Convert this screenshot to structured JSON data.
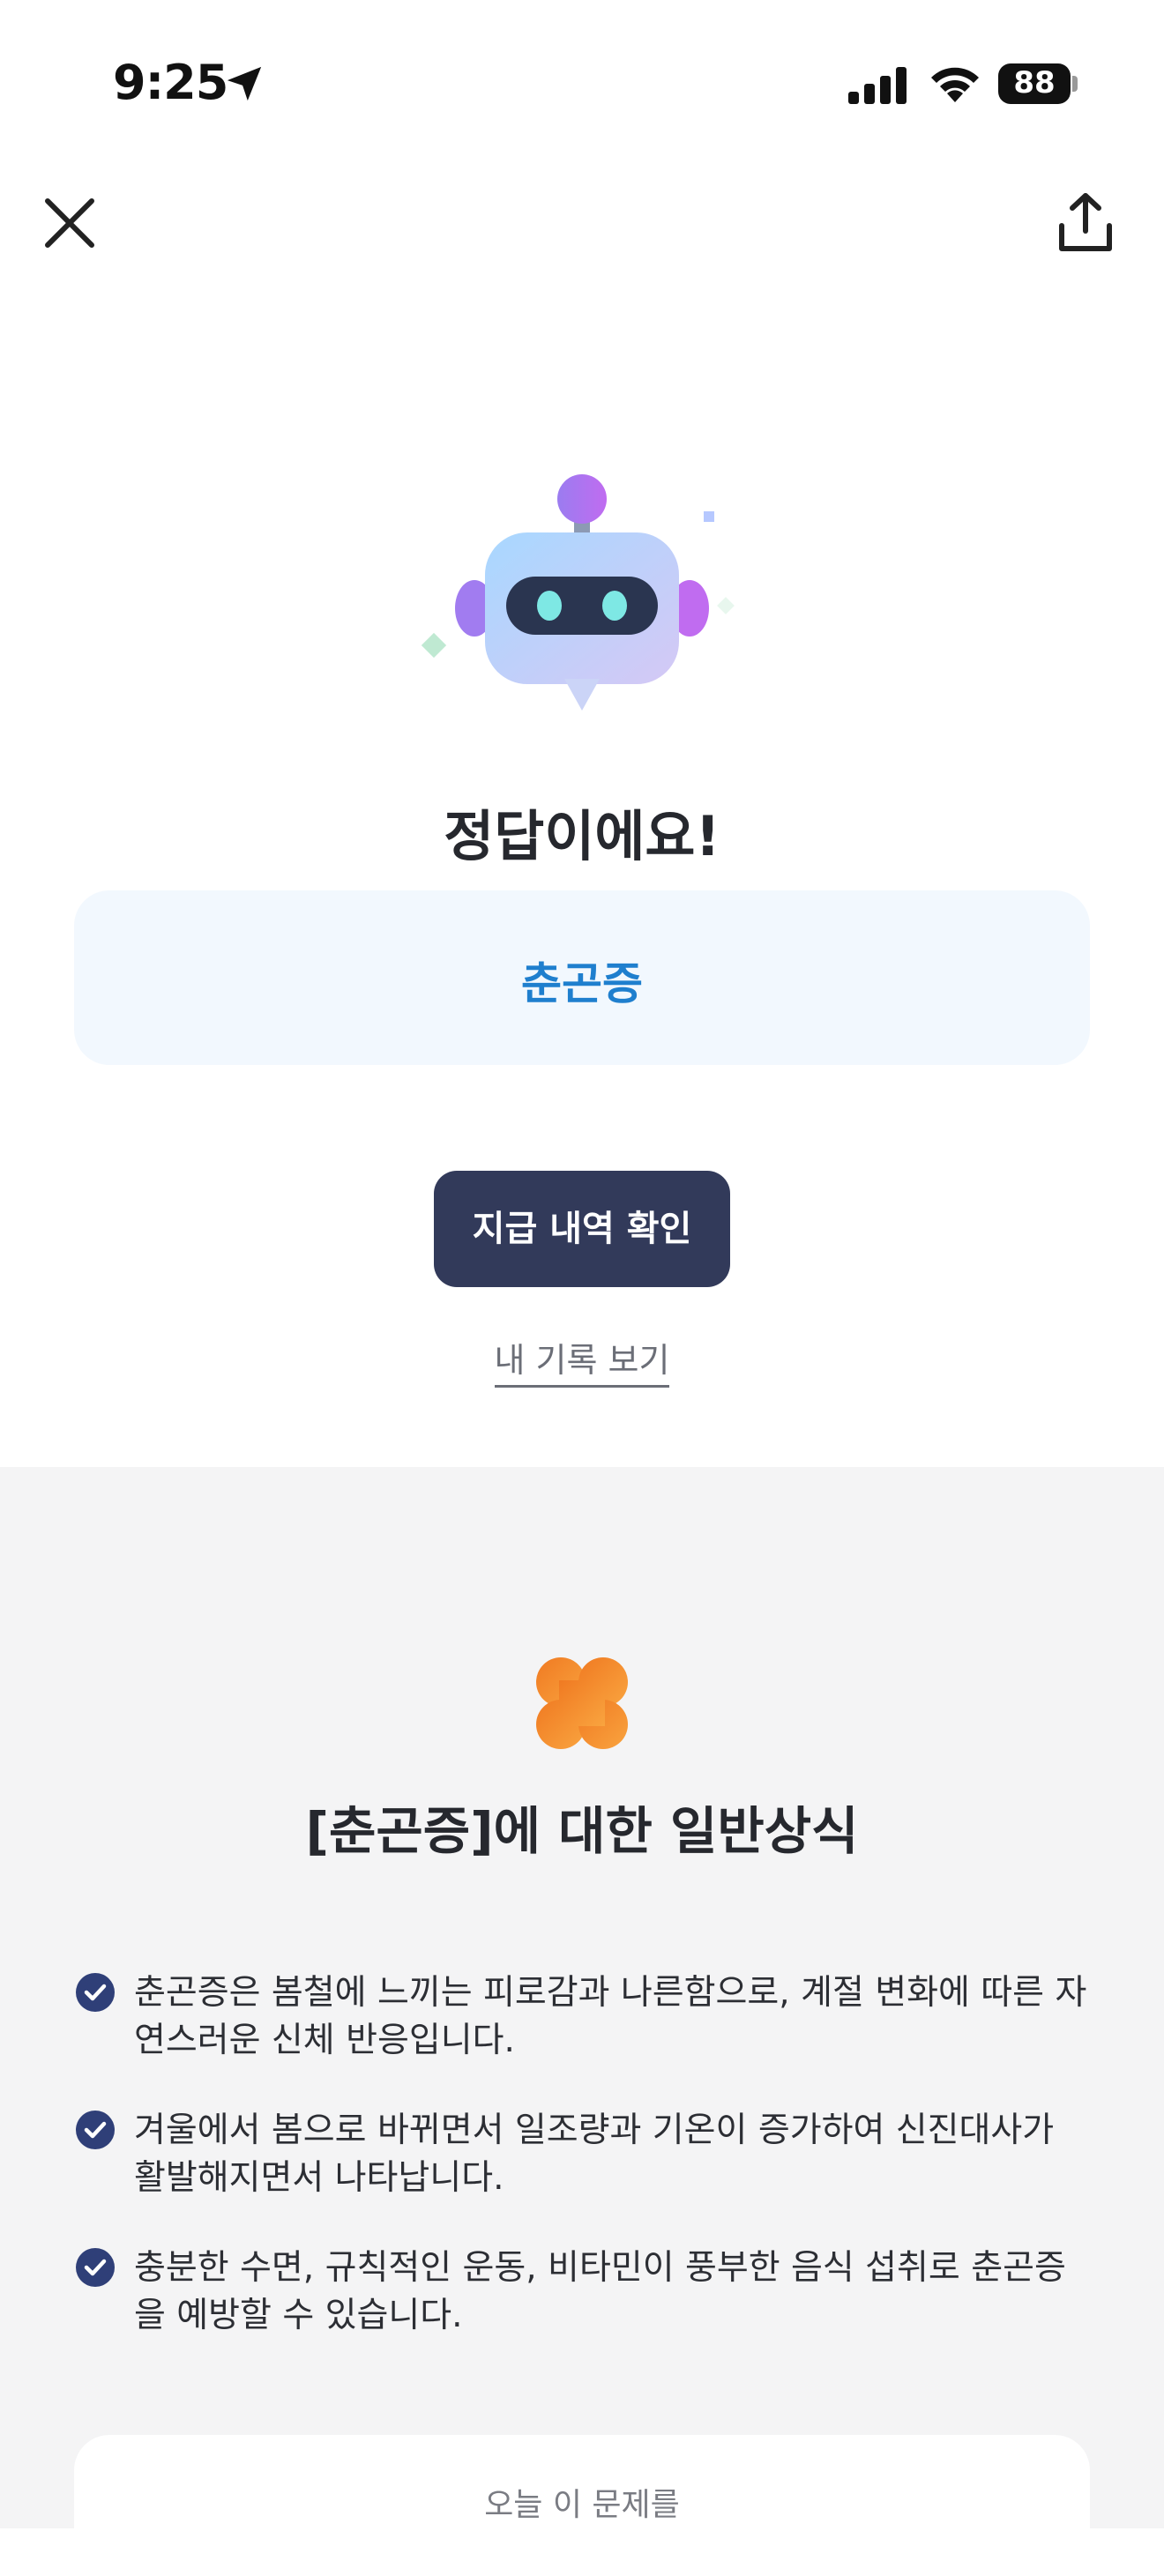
{
  "status_bar": {
    "time": "9:25",
    "battery": "88",
    "icons": [
      "location-arrow-icon",
      "cellular-signal-icon",
      "wifi-icon",
      "battery-icon"
    ]
  },
  "nav": {
    "close_icon": "close-icon",
    "share_icon": "share-icon"
  },
  "result": {
    "title": "정답이에요!",
    "answer": "춘곤증"
  },
  "actions": {
    "primary_button": "지급 내역 확인",
    "record_link": "내 기록 보기"
  },
  "info": {
    "title": "[춘곤증]에 대한 일반상식",
    "facts": [
      "춘곤증은 봄철에 느끼는 피로감과 나른함으로, 계절 변화에 따른 자연스러운 신체 반응입니다.",
      "겨울에서 봄으로 바뀌면서 일조량과 기온이 증가하여 신진대사가 활발해지면서 나타납니다.",
      "충분한 수면, 규칙적인 운동, 비타민이 풍부한 음식 섭취로 춘곤증을 예방할 수 있습니다."
    ],
    "bottom_card_text": "오늘 이 문제를"
  },
  "colors": {
    "answer_box_bg": "#f2f8fe",
    "answer_text": "#1f7fce",
    "primary_button_bg": "#323a5a",
    "info_section_bg": "#f4f4f5",
    "check_icon": "#2f3f78",
    "clover": "#f5872e"
  }
}
